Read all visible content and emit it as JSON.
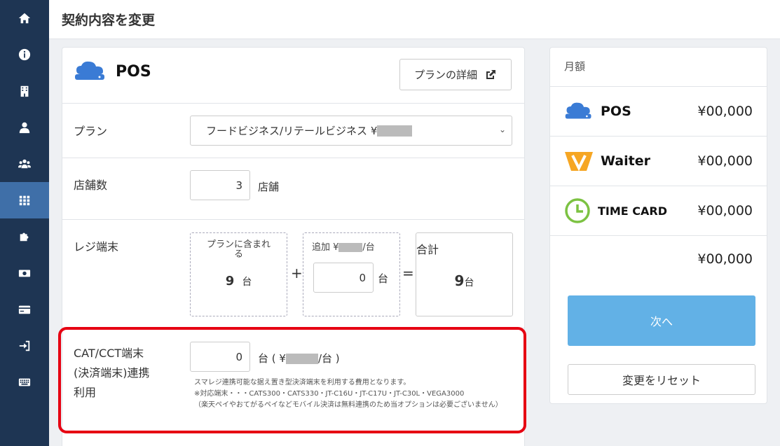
{
  "header": {
    "title": "契約内容を変更"
  },
  "sidebar": {
    "items": [
      {
        "icon": "home-icon"
      },
      {
        "icon": "info-icon"
      },
      {
        "icon": "building-icon"
      },
      {
        "icon": "user-icon"
      },
      {
        "icon": "users-icon"
      },
      {
        "icon": "grid-icon"
      },
      {
        "icon": "puzzle-icon"
      },
      {
        "icon": "money-icon"
      },
      {
        "icon": "credit-card-icon"
      },
      {
        "icon": "sign-in-icon"
      },
      {
        "icon": "keyboard-icon"
      }
    ],
    "active_item": "grid-icon"
  },
  "product": {
    "name": "POS",
    "detail_button": "プランの詳細"
  },
  "plan": {
    "label": "プラン",
    "selected": "フードビジネス/リテールビジネス ¥"
  },
  "stores": {
    "label": "店舗数",
    "value": "3",
    "unit": "店舗"
  },
  "register": {
    "label": "レジ端末",
    "included_label": "プランに含まれる",
    "included_value": "9",
    "included_unit": "台",
    "plus": "+",
    "add_label_prefix": "追加 ¥",
    "add_label_suffix": "/台",
    "add_value": "0",
    "add_unit": "台",
    "equals": "=",
    "total_label": "合計",
    "total_value": "9",
    "total_unit": "台"
  },
  "cat": {
    "label_line1": "CAT/CCT端末",
    "label_line2": "(決済端末)連携",
    "label_line3": "利用",
    "value": "0",
    "unit_prefix": "台 ( ¥",
    "unit_suffix": "/台 )",
    "note1": "スマレジ連携可能な据え置き型決済端末を利用する費用となります。",
    "note2": "※対応端末・・・CATS300・CATS330・JT-C16U・JT-C17U・JT-C30L・VEGA3000",
    "note3": "（楽天ペイやおてがるペイなどモバイル決済は無料連携のため当オプションは必要ございません）"
  },
  "summary": {
    "title": "月額",
    "items": [
      {
        "name": "POS",
        "price": "¥00,000"
      },
      {
        "name": "Waiter",
        "price": "¥00,000"
      },
      {
        "name": "TIME CARD",
        "price": "¥00,000"
      }
    ],
    "total": "¥00,000",
    "next_button": "次へ",
    "reset_button": "変更をリセット"
  },
  "colors": {
    "sidebar": "#1e3553",
    "sidebar_active": "#3f6fa8",
    "pos_blue": "#3a7bd5",
    "waiter_orange": "#f6a623",
    "timecard_green": "#7cc242",
    "next_button": "#62b1e6",
    "highlight_red": "#e60012"
  }
}
